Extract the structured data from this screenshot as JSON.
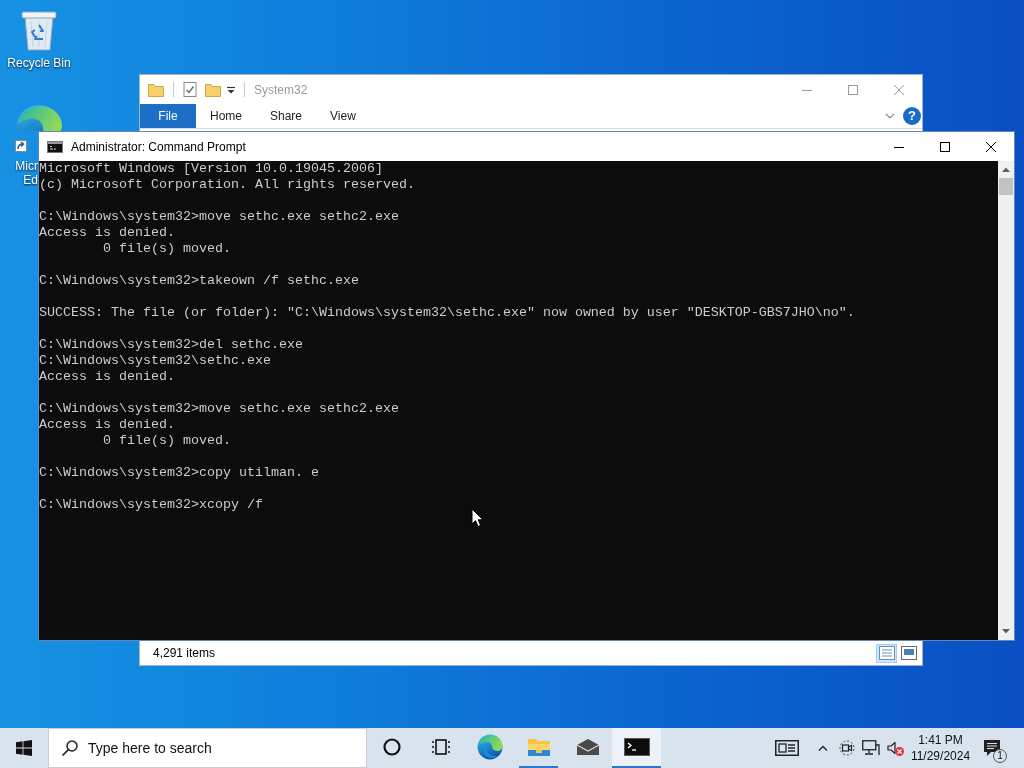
{
  "desktop_icons": [
    {
      "kind": "recycle-bin",
      "label_lines": [
        "Recycle Bin"
      ]
    },
    {
      "kind": "edge",
      "label_lines": [
        "Micr",
        "Ed"
      ]
    }
  ],
  "explorer_window": {
    "active": false,
    "title": "System32",
    "file_menu": "File",
    "ribbon_tabs": [
      "Home",
      "Share",
      "View"
    ],
    "help_glyph": "?",
    "status_text": "4,291 items",
    "view_buttons": [
      {
        "kind": "details",
        "selected": true
      },
      {
        "kind": "large-icons",
        "selected": false
      }
    ]
  },
  "cmd_window": {
    "active": true,
    "title": "Administrator: Command Prompt",
    "blocks": [
      [
        "Microsoft Windows [Version 10.0.19045.2006]",
        "(c) Microsoft Corporation. All rights reserved."
      ],
      [
        "C:\\Windows\\system32>move sethc.exe sethc2.exe",
        "Access is denied.",
        "        0 file(s) moved."
      ],
      [
        "C:\\Windows\\system32>takeown /f sethc.exe"
      ],
      [
        "SUCCESS: The file (or folder): \"C:\\Windows\\system32\\sethc.exe\" now owned by user \"DESKTOP-GBS7JHO\\no\"."
      ],
      [
        "C:\\Windows\\system32>del sethc.exe",
        "C:\\Windows\\system32\\sethc.exe",
        "Access is denied."
      ],
      [
        "C:\\Windows\\system32>move sethc.exe sethc2.exe",
        "Access is denied.",
        "        0 file(s) moved."
      ],
      [
        "C:\\Windows\\system32>copy utilman. e"
      ],
      [
        "C:\\Windows\\system32>xcopy /f"
      ]
    ]
  },
  "taskbar": {
    "search_placeholder": "Type here to search",
    "apps": [
      {
        "kind": "cortana",
        "running": false,
        "active": false
      },
      {
        "kind": "task-view",
        "running": false,
        "active": false
      },
      {
        "kind": "edge",
        "running": false,
        "active": false
      },
      {
        "kind": "file-explorer",
        "running": true,
        "active": false
      },
      {
        "kind": "mail",
        "running": false,
        "active": false
      },
      {
        "kind": "terminal",
        "running": true,
        "active": true
      }
    ],
    "tray": {
      "volume_muted": true,
      "time": "1:41 PM",
      "date": "11/29/2024",
      "notification_count": "1"
    }
  }
}
